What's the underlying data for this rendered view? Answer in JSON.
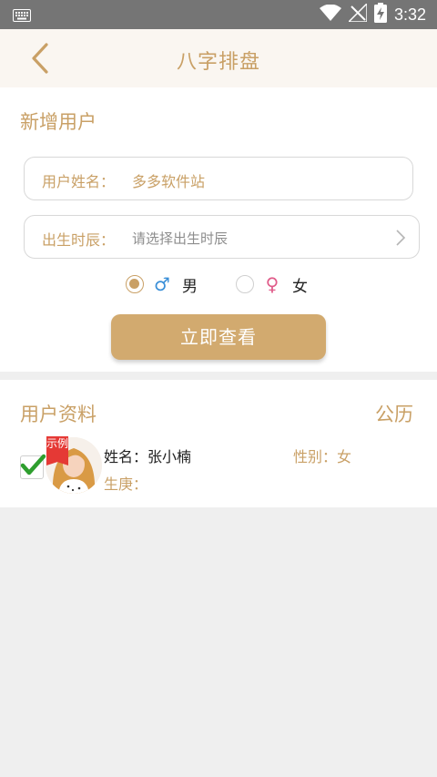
{
  "status_bar": {
    "time": "3:32",
    "icons": [
      "keyboard-icon",
      "wifi-icon",
      "no-signal-icon",
      "battery-charging-icon"
    ]
  },
  "header": {
    "title": "八字排盘",
    "back_icon": "chevron-left-icon"
  },
  "new_user": {
    "section_title": "新增用户",
    "name_label": "用户姓名：",
    "name_value": "多多软件站",
    "birth_label": "出生时辰：",
    "birth_placeholder": "请选择出生时辰",
    "gender_options": [
      {
        "symbol": "♂",
        "label": "男",
        "selected": true,
        "color": "#3a8fd8"
      },
      {
        "symbol": "♀",
        "label": "女",
        "selected": false,
        "color": "#e05c8a"
      }
    ],
    "submit_label": "立即查看"
  },
  "user_profile": {
    "section_title": "用户资料",
    "calendar_type": "公历",
    "records": [
      {
        "checked": true,
        "tag": "示例",
        "name_label": "姓名：",
        "name": "张小楠",
        "gender_label": "性别：",
        "gender": "女",
        "birth_label": "生庚：",
        "birth": ""
      }
    ]
  },
  "colors": {
    "accent": "#c9a066",
    "button": "#d2aa6f",
    "status_bar": "#757575",
    "header_bg": "#faf6f1",
    "page_bg": "#efefef",
    "check_green": "#2e9e2e",
    "tag_red": "#e53935"
  }
}
